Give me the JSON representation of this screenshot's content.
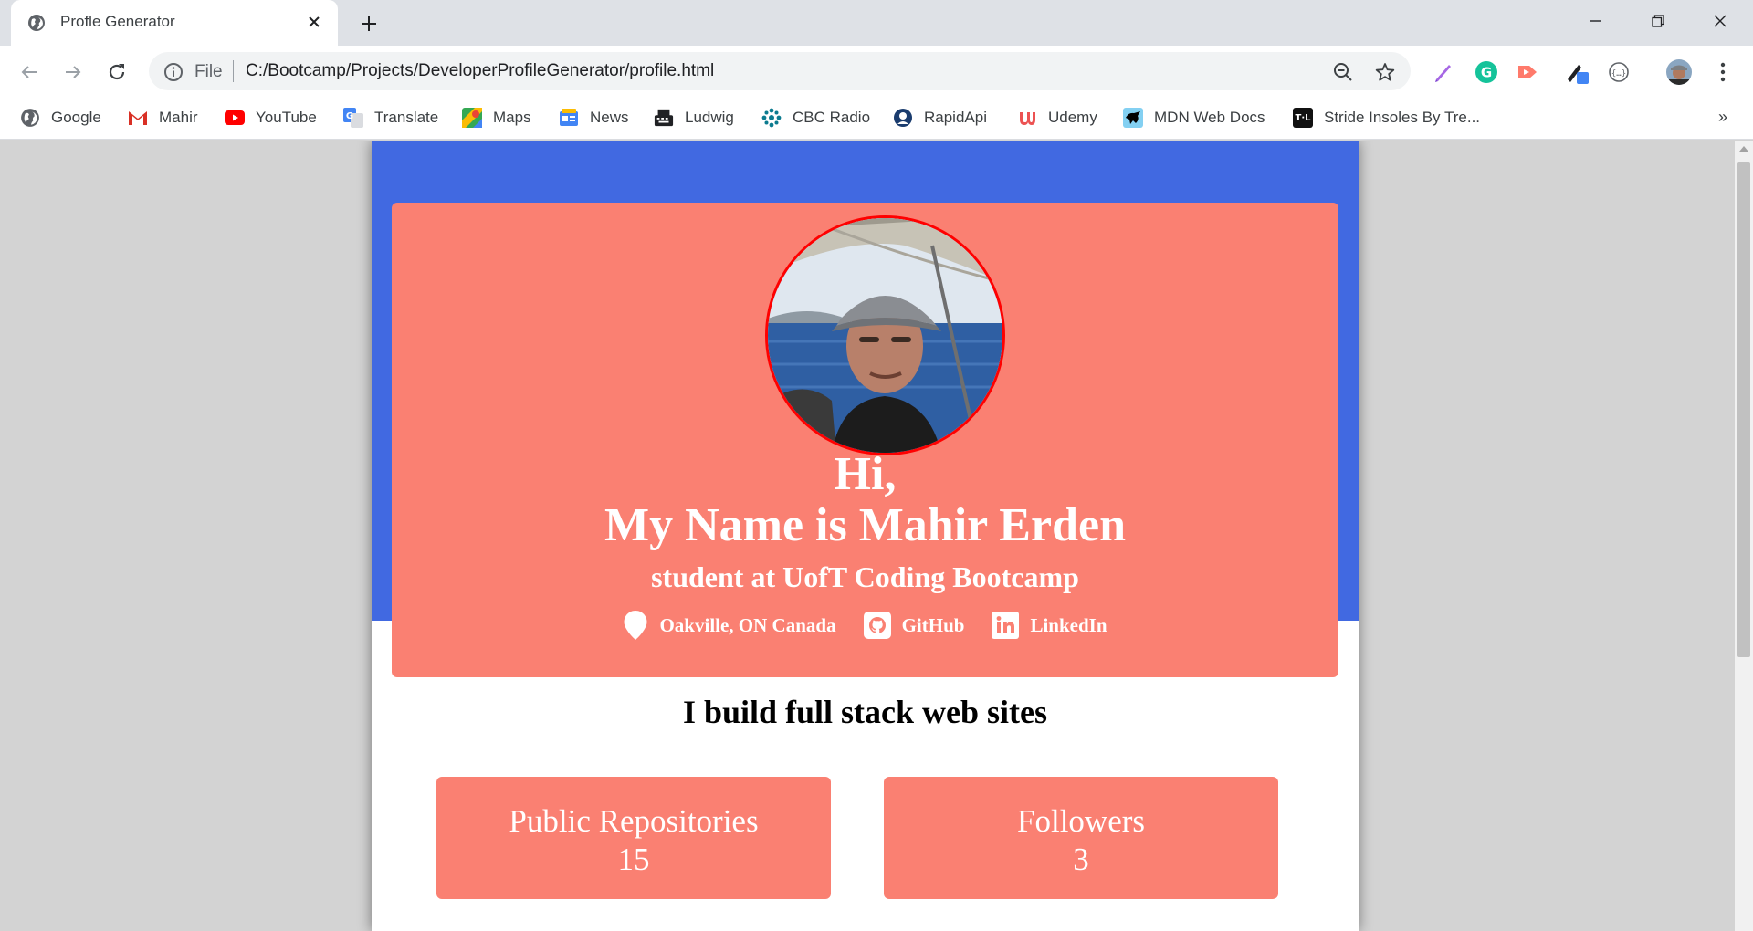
{
  "browser": {
    "tab_title": "Profle Generator",
    "omnibox": {
      "scheme_label": "File",
      "url": "C:/Bootcamp/Projects/DeveloperProfileGenerator/profile.html"
    },
    "bookmarks": [
      {
        "label": "Google",
        "icon": "google-globe-icon",
        "color": "#5f6368"
      },
      {
        "label": "Mahir",
        "icon": "gmail-icon",
        "color": "#d93025"
      },
      {
        "label": "YouTube",
        "icon": "youtube-icon",
        "color": "#ff0000"
      },
      {
        "label": "Translate",
        "icon": "translate-icon",
        "color": "#4285f4"
      },
      {
        "label": "Maps",
        "icon": "maps-icon",
        "color": "#34a853"
      },
      {
        "label": "News",
        "icon": "news-icon",
        "color": "#4285f4"
      },
      {
        "label": "Ludwig",
        "icon": "typewriter-icon",
        "color": "#202124"
      },
      {
        "label": "CBC Radio",
        "icon": "cbc-icon",
        "color": "#0c7b8f"
      },
      {
        "label": "RapidApi",
        "icon": "rapidapi-icon",
        "color": "#1a3c6e"
      },
      {
        "label": "Udemy",
        "icon": "udemy-icon",
        "color": "#ec5252"
      },
      {
        "label": "MDN Web Docs",
        "icon": "mdn-icon",
        "color": "#83d0f2"
      },
      {
        "label": "Stride Insoles By Tre...",
        "icon": "tl-icon",
        "color": "#111111"
      }
    ],
    "bookmarks_more": "»"
  },
  "profile": {
    "greeting": "Hi,",
    "name_line": "My Name is Mahir Erden",
    "subtitle": "student at UofT Coding Bootcamp",
    "location": "Oakville, ON Canada",
    "github_label": "GitHub",
    "linkedin_label": "LinkedIn",
    "bio": "I build full stack web sites",
    "stats": [
      {
        "label": "Public Repositories",
        "value": "15"
      },
      {
        "label": "Followers",
        "value": "3"
      }
    ]
  },
  "colors": {
    "band": "#4169e1",
    "card": "#fa8072",
    "photo_border": "#ff0000"
  }
}
